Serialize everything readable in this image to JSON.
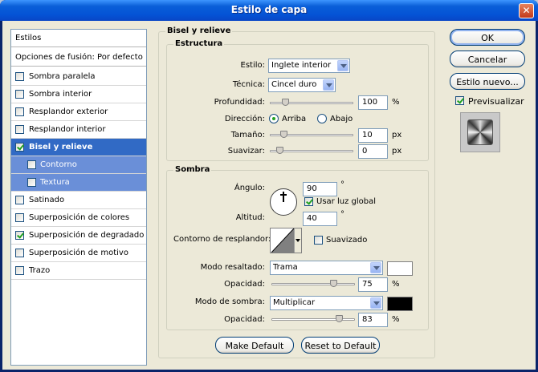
{
  "window": {
    "title": "Estilo de capa",
    "close_glyph": "✕"
  },
  "styles_list": {
    "header": "Estilos",
    "blend_options": "Opciones de fusión: Por defecto",
    "items": [
      {
        "label": "Sombra paralela",
        "checked": false
      },
      {
        "label": "Sombra interior",
        "checked": false
      },
      {
        "label": "Resplandor exterior",
        "checked": false
      },
      {
        "label": "Resplandor interior",
        "checked": false
      },
      {
        "label": "Bisel y relieve",
        "checked": true,
        "selected": true
      },
      {
        "label": "Contorno",
        "checked": false,
        "sub": true
      },
      {
        "label": "Textura",
        "checked": false,
        "sub": true
      },
      {
        "label": "Satinado",
        "checked": false
      },
      {
        "label": "Superposición de colores",
        "checked": false
      },
      {
        "label": "Superposición de degradado",
        "checked": true
      },
      {
        "label": "Superposición de motivo",
        "checked": false
      },
      {
        "label": "Trazo",
        "checked": false
      }
    ]
  },
  "panel": {
    "title": "Bisel y relieve",
    "structure": {
      "title": "Estructura",
      "style_label": "Estilo:",
      "style_value": "Inglete interior",
      "technique_label": "Técnica:",
      "technique_value": "Cincel duro",
      "depth_label": "Profundidad:",
      "depth_value": "100",
      "depth_unit": "%",
      "depth_level": 0.08,
      "direction_label": "Dirección:",
      "dir_up": "Arriba",
      "dir_down": "Abajo",
      "size_label": "Tamaño:",
      "size_value": "10",
      "size_unit": "px",
      "size_level": 0.06,
      "soften_label": "Suavizar:",
      "soften_value": "0",
      "soften_unit": "px",
      "soften_level": 0.0
    },
    "shading": {
      "title": "Sombra",
      "angle_label": "Ángulo:",
      "angle_value": "90",
      "angle_unit": "°",
      "global_light": "Usar luz global",
      "global_light_checked": true,
      "altitude_label": "Altitud:",
      "altitude_value": "40",
      "altitude_unit": "°",
      "gloss_label": "Contorno de resplandor:",
      "antialias": "Suavizado",
      "antialias_checked": false,
      "highlight_label": "Modo resaltado:",
      "highlight_value": "Trama",
      "highlight_color": "#ffffff",
      "hl_opacity_label": "Opacidad:",
      "hl_opacity_value": "75",
      "hl_opacity_unit": "%",
      "hl_opacity_level": 0.75,
      "shadow_label": "Modo de sombra:",
      "shadow_value": "Multiplicar",
      "shadow_color": "#000000",
      "sh_opacity_label": "Opacidad:",
      "sh_opacity_value": "83",
      "sh_opacity_unit": "%",
      "sh_opacity_level": 0.83
    },
    "make_default": "Make Default",
    "reset_default": "Reset to Default"
  },
  "actions": {
    "ok": "OK",
    "cancel": "Cancelar",
    "new_style": "Estilo nuevo...",
    "preview": "Previsualizar",
    "preview_checked": true
  }
}
